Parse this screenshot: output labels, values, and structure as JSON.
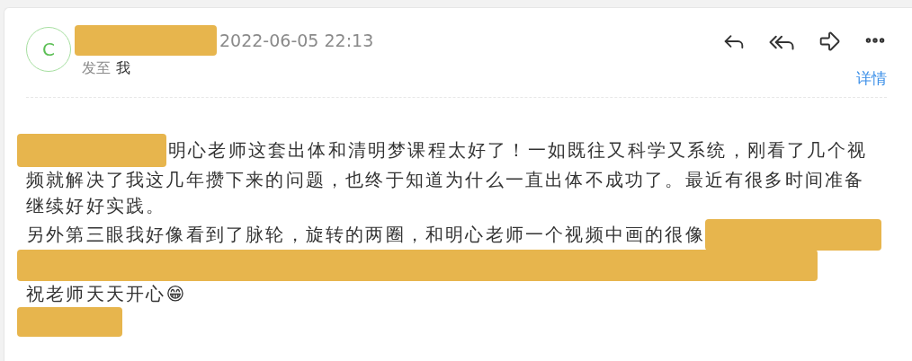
{
  "header": {
    "avatar": "C",
    "date": "2022-06-05 22:13",
    "to_label": "发至",
    "to": "我",
    "details_link": "详情"
  },
  "body": [
    {
      "kind": "lead",
      "text": "明心老师这套出体和清明梦课程太好了！一如既往又科学又系统，刚看了几个视"
    },
    {
      "kind": "plain",
      "text": "频就解决了我这几年攒下来的问题，也终于知道为什么一直出体不成功了。最近有很多时间准备继续好好实践。"
    },
    {
      "kind": "tail",
      "text": "另外第三眼我好像看到了脉轮，旋转的两圈，和明心老师一个视频中画的很像"
    },
    {
      "kind": "blank"
    },
    {
      "kind": "plain",
      "text": "祝老师天天开心😁"
    },
    {
      "kind": "stub"
    }
  ]
}
